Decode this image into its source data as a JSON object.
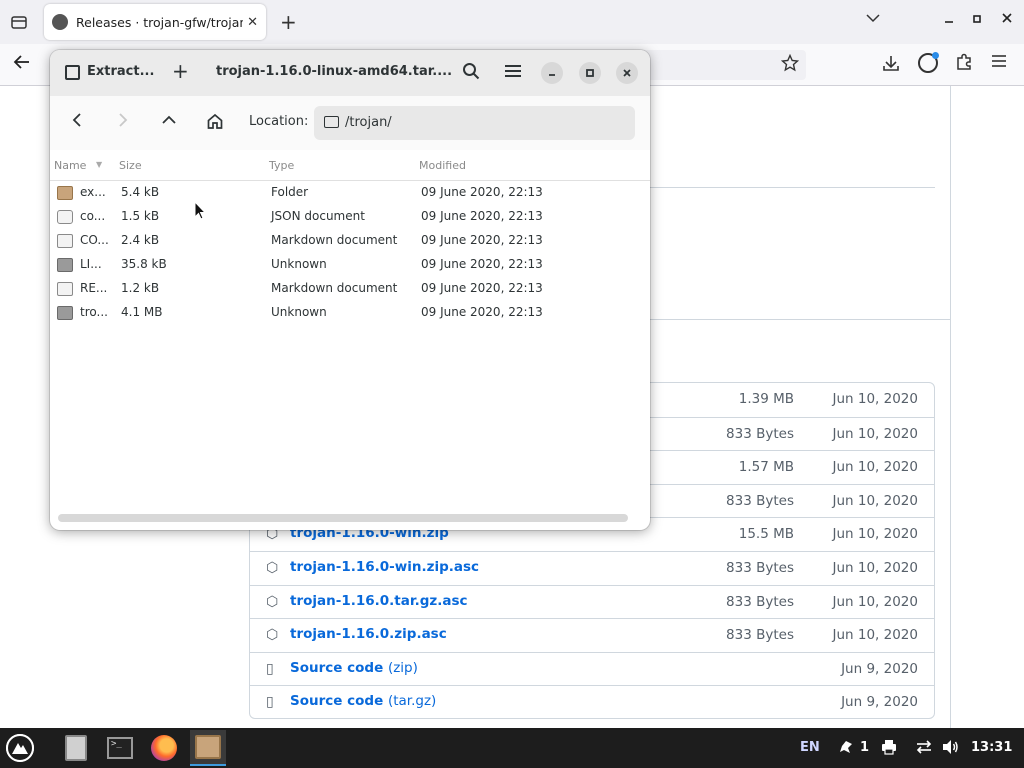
{
  "browser": {
    "tab_title": "Releases · trojan-gfw/trojan",
    "tab_close": "✕",
    "new_tab": "+"
  },
  "file_roller": {
    "extract_label": "Extract...",
    "add_label": "+",
    "title": "trojan-1.16.0-linux-amd64.tar....",
    "location_label": "Location:",
    "location_value": "/trojan/",
    "columns": {
      "name": "Name",
      "size": "Size",
      "type": "Type",
      "modified": "Modified"
    },
    "files": [
      {
        "name": "ex...",
        "size": "5.4 kB",
        "type": "Folder",
        "modified": "09 June 2020, 22:13",
        "icon": "folder-icon"
      },
      {
        "name": "co...",
        "size": "1.5 kB",
        "type": "JSON document",
        "modified": "09 June 2020, 22:13",
        "icon": "json-file-icon"
      },
      {
        "name": "CO...",
        "size": "2.4 kB",
        "type": "Markdown document",
        "modified": "09 June 2020, 22:13",
        "icon": "markdown-file-icon"
      },
      {
        "name": "LI...",
        "size": "35.8 kB",
        "type": "Unknown",
        "modified": "09 June 2020, 22:13",
        "icon": "binary-file-icon"
      },
      {
        "name": "RE...",
        "size": "1.2 kB",
        "type": "Markdown document",
        "modified": "09 June 2020, 22:13",
        "icon": "markdown-file-icon"
      },
      {
        "name": "tro...",
        "size": "4.1 MB",
        "type": "Unknown",
        "modified": "09 June 2020, 22:13",
        "icon": "binary-file-icon"
      }
    ]
  },
  "assets": [
    {
      "name": "",
      "suffix": "",
      "size": "1.39 MB",
      "date": "Jun 10, 2020",
      "icon": "package-icon"
    },
    {
      "name": "",
      "suffix": "",
      "size": "833 Bytes",
      "date": "Jun 10, 2020",
      "icon": "package-icon"
    },
    {
      "name": "",
      "suffix": "",
      "size": "1.57 MB",
      "date": "Jun 10, 2020",
      "icon": "package-icon"
    },
    {
      "name": "",
      "suffix": "",
      "size": "833 Bytes",
      "date": "Jun 10, 2020",
      "icon": "package-icon"
    },
    {
      "name": "trojan-1.16.0-win.zip",
      "suffix": "",
      "size": "15.5 MB",
      "date": "Jun 10, 2020",
      "icon": "package-icon"
    },
    {
      "name": "trojan-1.16.0-win.zip.asc",
      "suffix": "",
      "size": "833 Bytes",
      "date": "Jun 10, 2020",
      "icon": "package-icon"
    },
    {
      "name": "trojan-1.16.0.tar.gz.asc",
      "suffix": "",
      "size": "833 Bytes",
      "date": "Jun 10, 2020",
      "icon": "package-icon"
    },
    {
      "name": "trojan-1.16.0.zip.asc",
      "suffix": "",
      "size": "833 Bytes",
      "date": "Jun 10, 2020",
      "icon": "package-icon"
    },
    {
      "name": "Source code",
      "suffix": "(zip)",
      "size": "",
      "date": "Jun 9, 2020",
      "icon": "file-zip-icon"
    },
    {
      "name": "Source code",
      "suffix": "(tar.gz)",
      "size": "",
      "date": "Jun 9, 2020",
      "icon": "file-zip-icon"
    }
  ],
  "taskbar": {
    "language": "EN",
    "notification_count": "1",
    "clock": "13:31"
  }
}
